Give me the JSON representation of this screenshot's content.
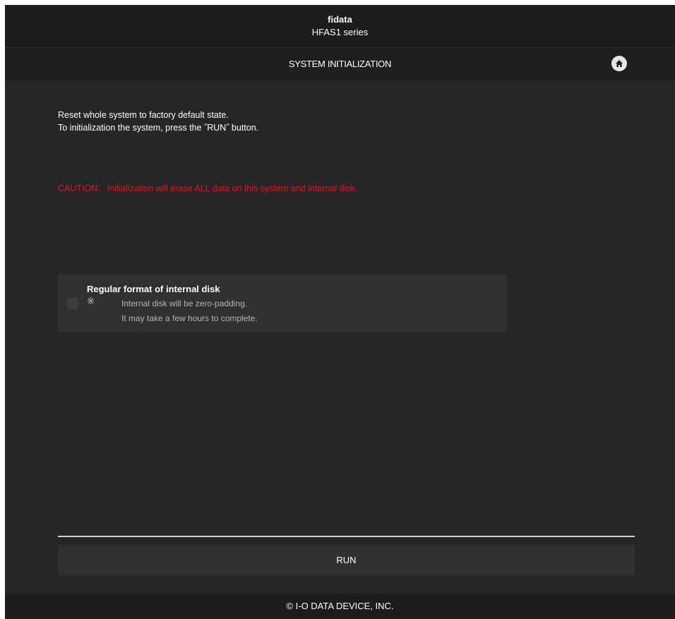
{
  "brand": {
    "name": "fidata",
    "model": "HFAS1 series"
  },
  "header": {
    "title": "SYSTEM INITIALIZATION",
    "home_icon": "home-icon"
  },
  "main": {
    "description_line1": "Reset whole system to factory default state.",
    "description_line2": "To initialization the system, press the ˝RUN˝ button.",
    "caution_label": "CAUTION:",
    "caution_text": "Initialization will erase ALL data on this system and internal disk.",
    "option": {
      "label": "Regular format of internal disk",
      "note_mark": "※",
      "note_line1": "Internal disk will be zero-padding.",
      "note_line2": "It may take a few hours to complete.",
      "checked": false
    },
    "run_label": "RUN"
  },
  "footer": {
    "copyright": "© I-O DATA DEVICE, INC."
  },
  "colors": {
    "background": "#262626",
    "caution": "#e8101e",
    "text": "#ffffff"
  }
}
